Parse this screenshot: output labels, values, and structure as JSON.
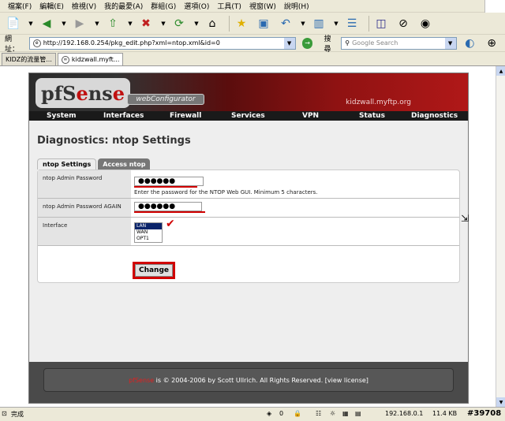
{
  "menu": [
    "檔案(F)",
    "編輯(E)",
    "檢視(V)",
    "我的最愛(A)",
    "群組(G)",
    "選項(O)",
    "工具(T)",
    "視窗(W)",
    "說明(H)"
  ],
  "address": {
    "label": "網址：",
    "url": "http://192.168.0.254/pkg_edit.php?xml=ntop.xml&id=0"
  },
  "search": {
    "label": "搜尋",
    "placeholder": "Google Search"
  },
  "tabs": [
    {
      "label": "KIDZ的流量管..."
    },
    {
      "label": "kidzwall.myft..."
    }
  ],
  "header": {
    "logo_left": "pfS",
    "logo_e": "e",
    "logo_right": "ns",
    "logo_end": "e",
    "webconfigurator": "webConfigurator",
    "hostname": "kidzwall.myftp.org"
  },
  "nav": [
    "System",
    "Interfaces",
    "Firewall",
    "Services",
    "VPN",
    "Status",
    "Diagnostics"
  ],
  "page_title": "Diagnostics: ntop Settings",
  "page_tabs": [
    "ntop Settings",
    "Access ntop"
  ],
  "form": {
    "pw_label": "ntop Admin Password",
    "pw_value": "●●●●●●",
    "pw_hint": "Enter the password for the NTOP Web GUI. Minimum 5 characters.",
    "pw2_label": "ntop Admin Password AGAIN",
    "pw2_value": "●●●●●●",
    "iface_label": "Interface",
    "iface_options": [
      "LAN",
      "WAN",
      "OPT1"
    ],
    "submit": "Change"
  },
  "footer": {
    "brand": "pfSense",
    "text": " is © 2004-2006 by Scott Ullrich. All Rights Reserved. [view license]"
  },
  "status": {
    "text": "完成",
    "count": "0",
    "ip": "192.168.0.1",
    "size": "11.4 KB",
    "tag": "#39708"
  }
}
